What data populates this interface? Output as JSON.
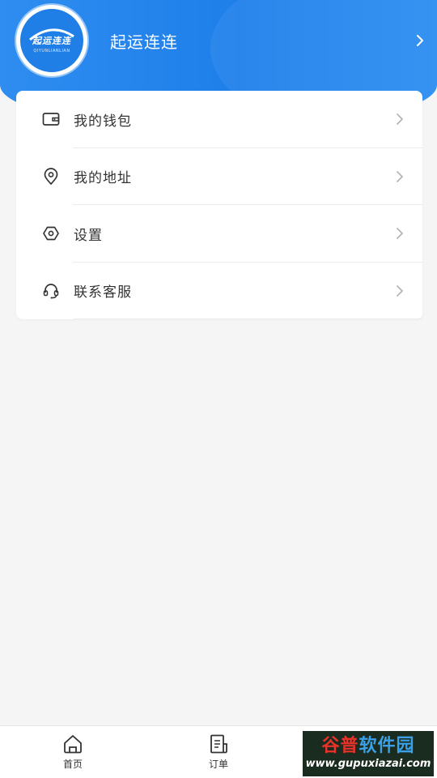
{
  "header": {
    "app_name": "起运连连",
    "logo_text_cn": "起运连连",
    "logo_text_en": "QIYUNLIANLIAN"
  },
  "menu": {
    "items": [
      {
        "label": "我的钱包",
        "icon": "wallet-icon"
      },
      {
        "label": "我的地址",
        "icon": "location-pin-icon"
      },
      {
        "label": "设置",
        "icon": "settings-hexagon-icon"
      },
      {
        "label": "联系客服",
        "icon": "headset-icon"
      }
    ]
  },
  "tabbar": {
    "tabs": [
      {
        "label": "首页",
        "icon": "home-icon"
      },
      {
        "label": "订单",
        "icon": "order-list-icon"
      }
    ]
  },
  "watermark": {
    "text_cn_1": "谷普",
    "text_cn_2": "软件园",
    "text_en": "www.gupuxiazai.com"
  },
  "colors": {
    "header_gradient_start": "#2f8df0",
    "header_gradient_end": "#1e7fea",
    "page_background": "#f5f5f6",
    "text_primary": "#333333",
    "chevron": "#b5b5b5"
  }
}
